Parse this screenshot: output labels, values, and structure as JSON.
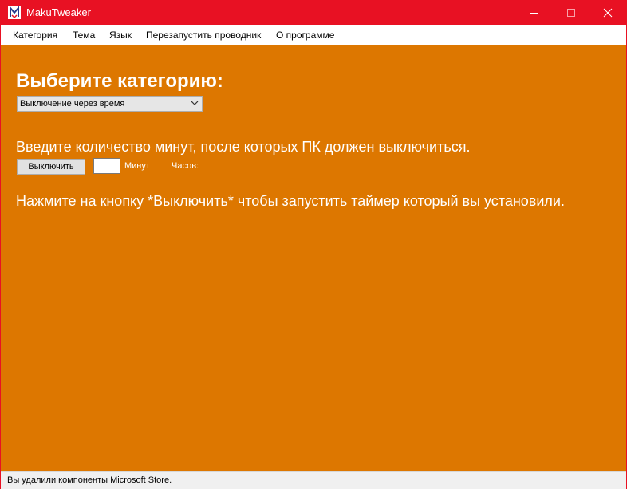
{
  "window": {
    "title": "MakuTweaker",
    "accent_color": "#e81123",
    "background_color": "#dd7700"
  },
  "menu": {
    "items": [
      {
        "label": "Категория"
      },
      {
        "label": "Тема"
      },
      {
        "label": "Язык"
      },
      {
        "label": "Перезапустить проводник"
      },
      {
        "label": "О программе"
      }
    ]
  },
  "main": {
    "heading": "Выберите категорию:",
    "category_select": {
      "selected": "Выключение через время"
    },
    "instruction": "Введите количество минут, после которых ПК должен выключиться.",
    "shutdown_button": "Выключить",
    "minutes_input": {
      "value": ""
    },
    "minutes_label": "Минут",
    "hours_label": "Часов:",
    "hint": "Нажмите на кнопку *Выключить* чтобы запустить таймер который вы установили."
  },
  "statusbar": {
    "text": "Вы удалили компоненты Microsoft Store."
  },
  "icons": {
    "app": "maku-logo-icon",
    "minimize": "minimize-icon",
    "maximize": "maximize-icon",
    "close": "close-icon",
    "dropdown": "chevron-down-icon"
  }
}
